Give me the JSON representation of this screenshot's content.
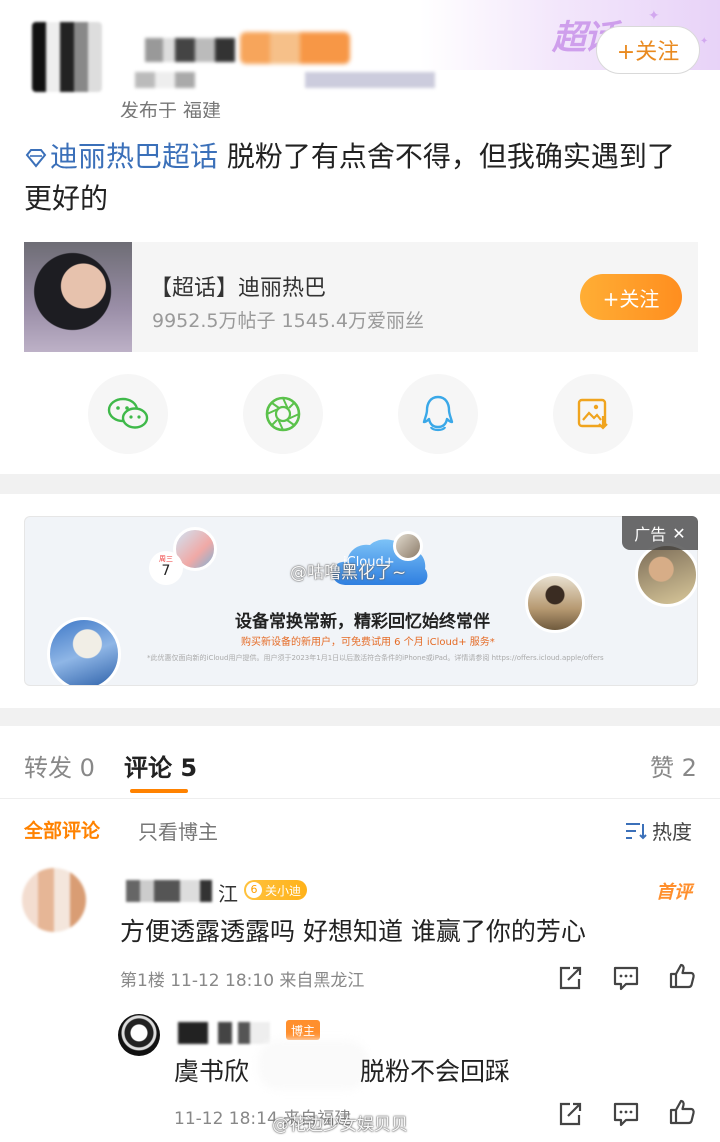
{
  "header": {
    "post_source": "发布于 福建",
    "follow_label": "+关注",
    "supertopic_mark": "超话"
  },
  "post": {
    "topic_link": "迪丽热巴超话",
    "text": " 脱粉了有点舍不得，但我确实遇到了更好的"
  },
  "topic_card": {
    "title": "【超话】迪丽热巴",
    "stats": "9952.5万帖子 1545.4万爱丽丝",
    "follow_label": "+关注"
  },
  "share": {
    "items": [
      "wechat-icon",
      "moments-icon",
      "qq-icon",
      "save-image-icon"
    ],
    "colors": {
      "wechat": "#3fb94a",
      "moments": "#5bc24b",
      "qq": "#3aa8e8",
      "save": "#f0a41e"
    }
  },
  "ad": {
    "badge": "广告",
    "date_day": "周三",
    "date_num": "7",
    "cloud_label": "iCloud+",
    "headline": "设备常换常新，精彩回忆始终常伴",
    "subline": "购买新设备的新用户，可免费试用 6 个月 iCloud+ 服务*",
    "fineprint": "*此优惠仅面向新的iCloud用户提供。用户须于2023年1月1日以后激活符合条件的iPhone或iPad。详情请参阅 https://offers.icloud.apple/offers",
    "watermark": "@咕噜黑化了~"
  },
  "tabs": {
    "repost": "转发 0",
    "comments": "评论 5",
    "likes": "赞 2"
  },
  "filters": {
    "all": "全部评论",
    "blogger_only": "只看博主",
    "sort": "热度"
  },
  "comments": [
    {
      "name_tail": "江",
      "fan_level": "6",
      "fan_badge": "关小迪",
      "first_review": "首评",
      "text": "方便透露透露吗 好想知道 谁赢了你的芳心",
      "meta": "第1楼 11-12 18:10 来自黑龙江"
    },
    {
      "blogger_tag": "博主",
      "text_start": "虞书欣",
      "text_end": "脱粉不会回踩",
      "meta": "11-12 18:14 来自福建"
    }
  ],
  "watermark_bottom": "@花边少女娱贝贝"
}
